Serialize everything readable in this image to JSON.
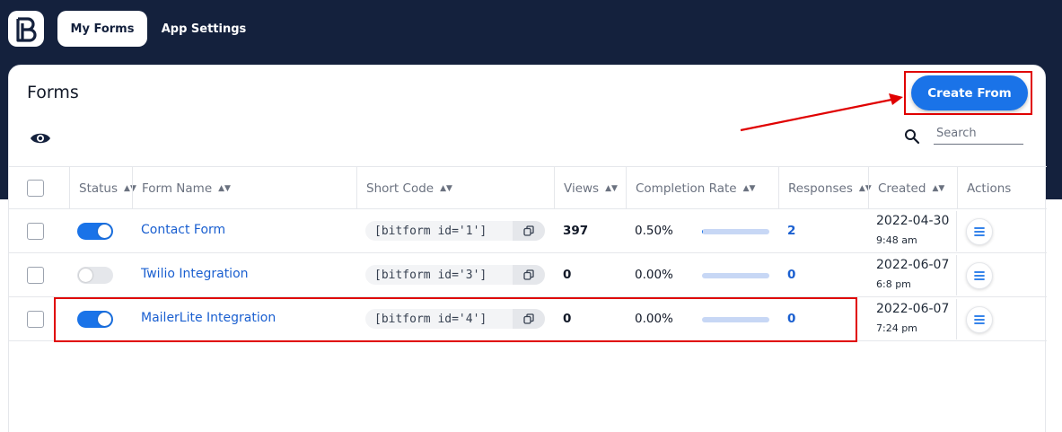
{
  "nav": {
    "tabs": [
      {
        "label": "My Forms",
        "active": true
      },
      {
        "label": "App Settings",
        "active": false
      }
    ]
  },
  "page": {
    "title": "Forms",
    "create_label": "Create From",
    "search_placeholder": "Search"
  },
  "table": {
    "columns": [
      "Status",
      "Form Name",
      "Short Code",
      "Views",
      "Completion Rate",
      "Responses",
      "Created",
      "Actions"
    ],
    "rows": [
      {
        "enabled": true,
        "name": "Contact Form",
        "shortcode": "[bitform id='1']",
        "views": "397",
        "rate": "0.50%",
        "rate_fraction": 0.005,
        "responses": "2",
        "date": "2022-04-30",
        "time": "9:48 am"
      },
      {
        "enabled": false,
        "name": "Twilio Integration",
        "shortcode": "[bitform id='3']",
        "views": "0",
        "rate": "0.00%",
        "rate_fraction": 0.0,
        "responses": "0",
        "date": "2022-06-07",
        "time": "6:8 pm"
      },
      {
        "enabled": true,
        "name": "MailerLite Integration",
        "shortcode": "[bitform id='4']",
        "views": "0",
        "rate": "0.00%",
        "rate_fraction": 0.0,
        "responses": "0",
        "date": "2022-06-07",
        "time": "7:24 pm"
      }
    ]
  },
  "colors": {
    "navbar": "#14213d",
    "accent": "#1a73e8",
    "annotation": "#e00000"
  }
}
